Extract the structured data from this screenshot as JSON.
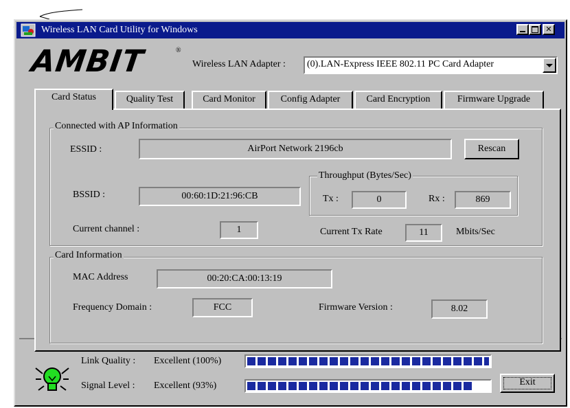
{
  "window": {
    "title": "Wireless LAN Card Utility for Windows"
  },
  "header": {
    "logo_text": "AMBIT",
    "adapter_label": "Wireless LAN Adapter :",
    "adapter_value": "(0).LAN-Express IEEE 802.11 PC Card Adapter"
  },
  "tabs": [
    {
      "label": "Card Status",
      "active": true
    },
    {
      "label": "Quality Test"
    },
    {
      "label": "Card Monitor"
    },
    {
      "label": "Config Adapter"
    },
    {
      "label": "Card Encryption"
    },
    {
      "label": "Firmware Upgrade"
    }
  ],
  "ap_info": {
    "group_title": "Connected with AP Information",
    "essid_label": "ESSID :",
    "essid_value": "AirPort Network 2196cb",
    "rescan_label": "Rescan",
    "bssid_label": "BSSID :",
    "bssid_value": "00:60:1D:21:96:CB",
    "channel_label": "Current channel :",
    "channel_value": "1",
    "throughput": {
      "title": "Throughput (Bytes/Sec)",
      "tx_label": "Tx :",
      "tx_value": "0",
      "rx_label": "Rx :",
      "rx_value": "869"
    },
    "txrate_label": "Current Tx Rate",
    "txrate_value": "11",
    "txrate_unit": "Mbits/Sec"
  },
  "card_info": {
    "group_title": "Card Information",
    "mac_label": "MAC Address",
    "mac_value": "00:20:CA:00:13:19",
    "freq_label": "Frequency Domain :",
    "freq_value": "FCC",
    "fw_label": "Firmware Version :",
    "fw_value": "8.02"
  },
  "status": {
    "link_label": "Link Quality :",
    "link_value": "Excellent (100%)",
    "link_percent": 100,
    "signal_label": "Signal Level :",
    "signal_value": "Excellent (93%)",
    "signal_percent": 93,
    "exit_label": "Exit"
  },
  "colors": {
    "titlebar": "#0a1a8c",
    "bar_fill": "#1a2aa0",
    "bulb": "#22dd22"
  }
}
